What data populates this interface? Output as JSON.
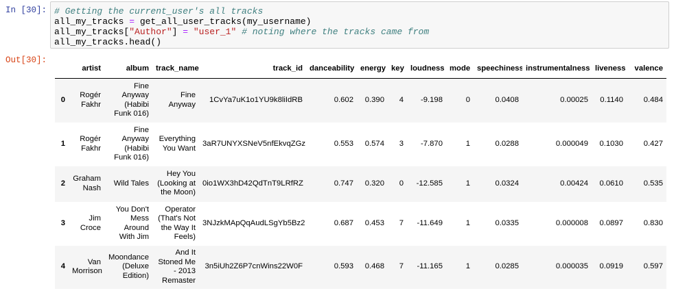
{
  "input_prompt": "In [30]:",
  "output_prompt": "Out[30]:",
  "code": {
    "line1_comment": "# Getting the current_user's all tracks",
    "line2_a": "all_my_tracks ",
    "line2_op": "=",
    "line2_b": " get_all_user_tracks(my_username)",
    "line3_a": "all_my_tracks[",
    "line3_str1": "\"Author\"",
    "line3_b": "] ",
    "line3_op": "=",
    "line3_c": " ",
    "line3_str2": "\"user_1\"",
    "line3_d": " ",
    "line3_comment": "# noting where the tracks came from",
    "line4": "all_my_tracks.head()"
  },
  "table": {
    "columns": [
      "artist",
      "album",
      "track_name",
      "track_id",
      "danceability",
      "energy",
      "key",
      "loudness",
      "mode",
      "speechiness",
      "instrumentalness",
      "liveness",
      "valence"
    ],
    "rows": [
      {
        "index": "0",
        "cells": [
          "Rogér Fakhr",
          "Fine Anyway (Habibi Funk 016)",
          "Fine Anyway",
          "1CvYa7uK1o1YU9k8liIdRB",
          "0.602",
          "0.390",
          "4",
          "-9.198",
          "0",
          "0.0408",
          "0.00025",
          "0.1140",
          "0.484"
        ]
      },
      {
        "index": "1",
        "cells": [
          "Rogér Fakhr",
          "Fine Anyway (Habibi Funk 016)",
          "Everything You Want",
          "3aR7UNYXSNeV5nfEkvqZGz",
          "0.553",
          "0.574",
          "3",
          "-7.870",
          "1",
          "0.0288",
          "0.000049",
          "0.1030",
          "0.427"
        ]
      },
      {
        "index": "2",
        "cells": [
          "Graham Nash",
          "Wild Tales",
          "Hey You (Looking at the Moon)",
          "0io1WX3hD42QdTnT9LRfRZ",
          "0.747",
          "0.320",
          "0",
          "-12.585",
          "1",
          "0.0324",
          "0.00424",
          "0.0610",
          "0.535"
        ]
      },
      {
        "index": "3",
        "cells": [
          "Jim Croce",
          "You Don't Mess Around With Jim",
          "Operator (That's Not the Way It Feels)",
          "3NJzkMApQqAudLSgYb5Bz2",
          "0.687",
          "0.453",
          "7",
          "-11.649",
          "1",
          "0.0335",
          "0.000008",
          "0.0897",
          "0.830"
        ]
      },
      {
        "index": "4",
        "cells": [
          "Van Morrison",
          "Moondance (Deluxe Edition)",
          "And It Stoned Me - 2013 Remaster",
          "3n5iUh2Z6P7cnWins22W0F",
          "0.593",
          "0.468",
          "7",
          "-11.165",
          "1",
          "0.0285",
          "0.000035",
          "0.0919",
          "0.597"
        ]
      }
    ]
  }
}
